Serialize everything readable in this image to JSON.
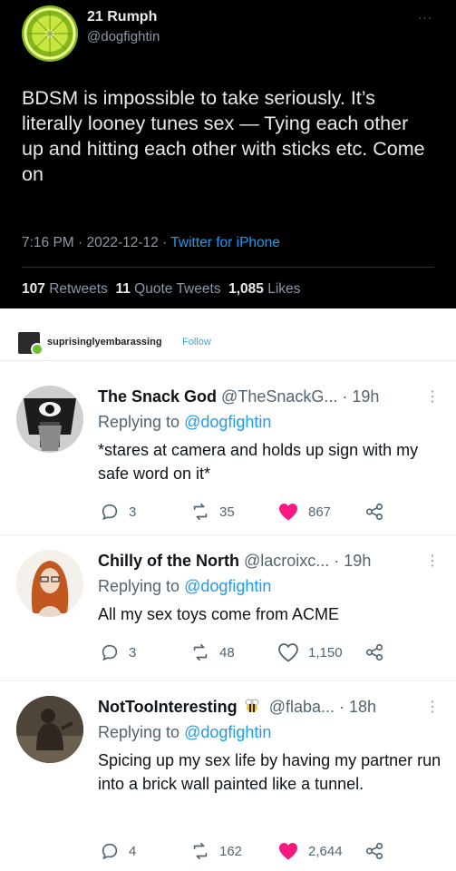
{
  "main_tweet": {
    "name": "21 Rumph",
    "handle": "@dogfightin",
    "more": "···",
    "text": "BDSM is impossible to take seriously. It’s literally looney tunes sex — Tying each other up and hitting each other with sticks etc. Come on",
    "time": "7:16 PM · 2022-12-12 · ",
    "source": "Twitter for iPhone",
    "retweets_count": "107",
    "retweets_label": "Retweets",
    "quotes_count": "11",
    "quotes_label": "Quote Tweets",
    "likes_count": "1,085",
    "likes_label": "Likes"
  },
  "tumblr": {
    "username": "suprisinglyembarassing",
    "follow": "Follow"
  },
  "replies": [
    {
      "name": "The Snack God",
      "handle": "@TheSnackG... · 19h",
      "replying_prefix": "Replying to ",
      "replying_to": "@dogfightin",
      "text": "*stares at camera and holds up sign with my safe word on it*",
      "replies": "3",
      "retweets": "35",
      "likes": "867",
      "liked": true
    },
    {
      "name": "Chilly of the North",
      "handle": "@lacroixc... · 19h",
      "replying_prefix": "Replying to ",
      "replying_to": "@dogfightin",
      "text": "All my sex toys come from ACME",
      "replies": "3",
      "retweets": "48",
      "likes": "1,150",
      "liked": false
    },
    {
      "name": "NotTooInteresting",
      "handle": "@flaba... · 18h",
      "replying_prefix": "Replying to ",
      "replying_to": "@dogfightin",
      "text": "Spicing up my sex life by having my partner run into a brick wall painted like a tunnel.",
      "replies": "4",
      "retweets": "162",
      "likes": "2,644",
      "liked": true
    }
  ],
  "colors": {
    "link_blue": "#1d9bf0",
    "like_pink": "#f91880",
    "muted": "#536471"
  },
  "icons": [
    "reply-icon",
    "retweet-icon",
    "heart-icon",
    "share-icon",
    "more-icon",
    "bee-icon"
  ]
}
